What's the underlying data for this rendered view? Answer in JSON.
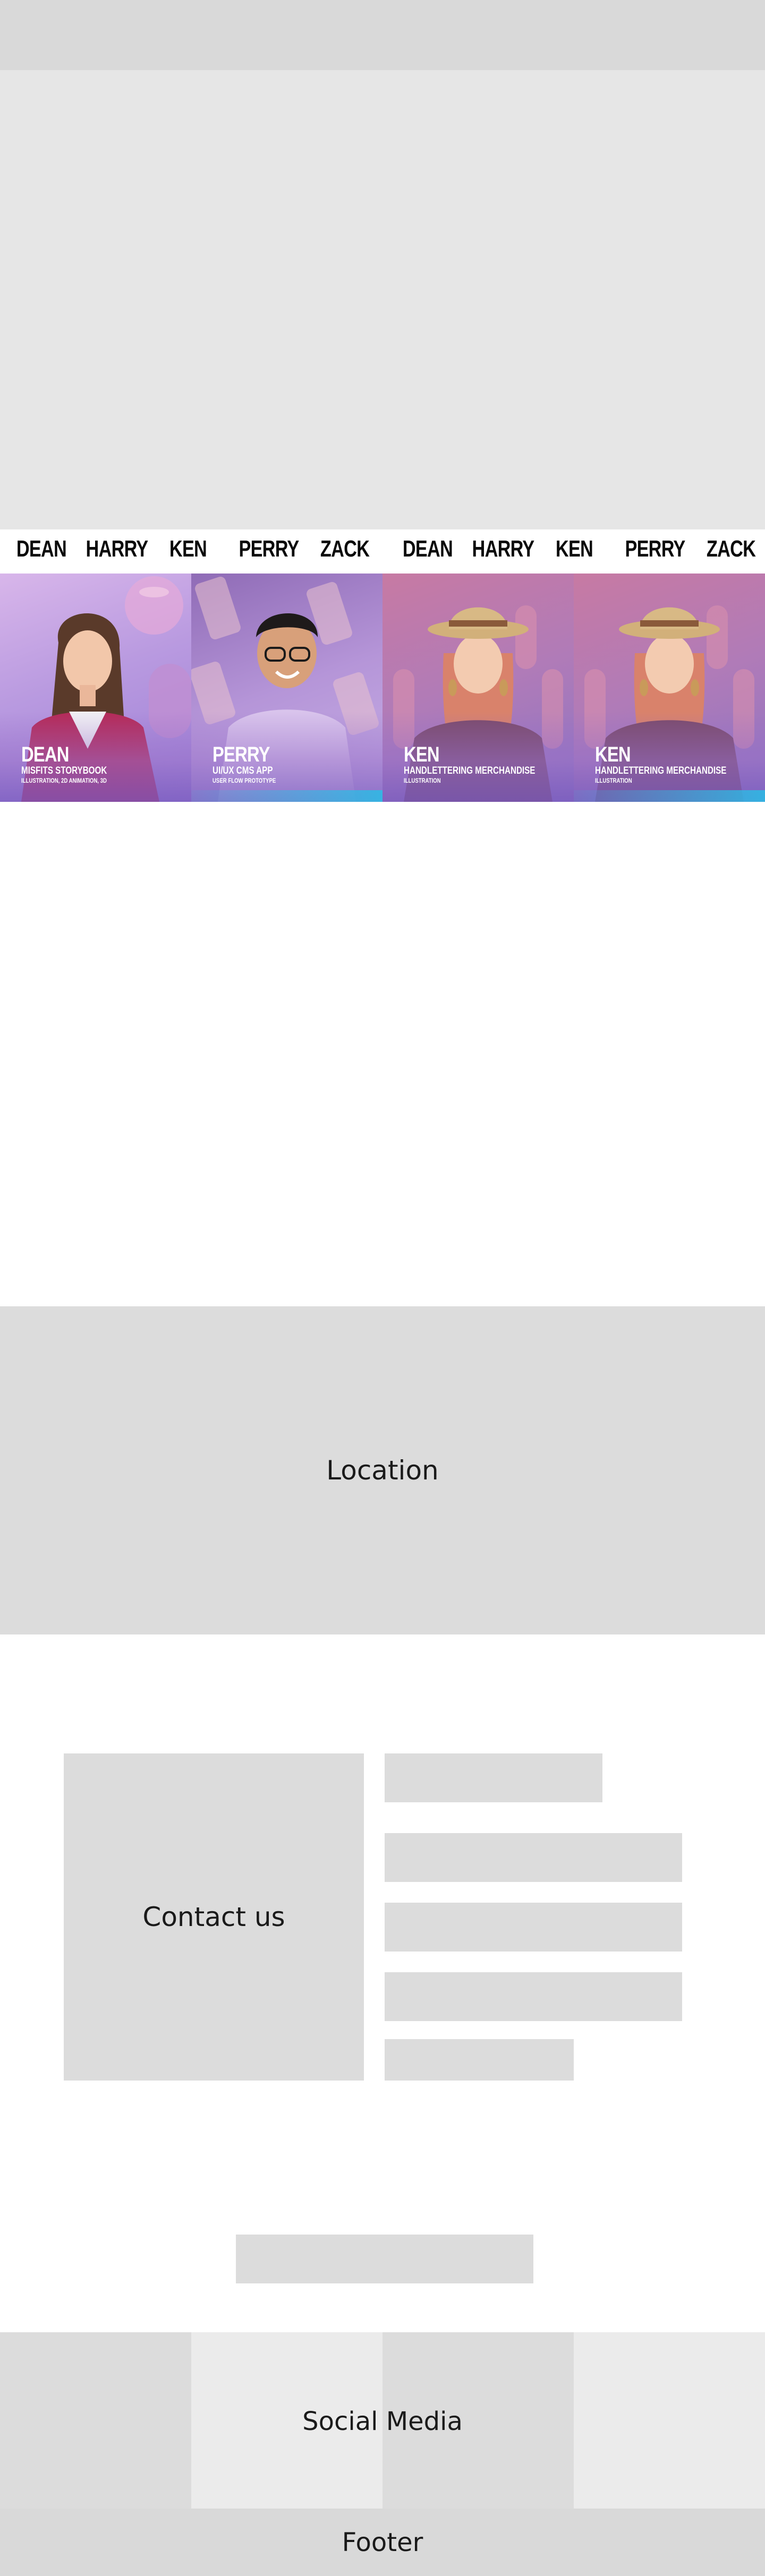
{
  "name_strip": [
    "DEAN",
    "HARRY",
    "KEN",
    "PERRY",
    "ZACK",
    "DEAN",
    "HARRY",
    "KEN",
    "PERRY",
    "ZACK"
  ],
  "cards": [
    {
      "name": "DEAN",
      "project": "MISFITS STORYBOOK",
      "tags": "ILLUSTRATION, 2D ANIMATION, 3D"
    },
    {
      "name": "PERRY",
      "project": "UI/UX CMS APP",
      "tags": "USER FLOW PROTOTYPE"
    },
    {
      "name": "KEN",
      "project": "HANDLETTERING MERCHANDISE",
      "tags": "ILLUSTRATION"
    },
    {
      "name": "KEN",
      "project": "HANDLETTERING MERCHANDISE",
      "tags": "ILLUSTRATION"
    }
  ],
  "location": {
    "label": "Location"
  },
  "contact": {
    "label": "Contact us"
  },
  "social": {
    "label": "Social Media"
  },
  "footer": {
    "label": "Footer"
  },
  "colors": {
    "placeholder": "#dcdcdc",
    "hero": "#e6e6e6",
    "card_accent": "#28bee6"
  }
}
